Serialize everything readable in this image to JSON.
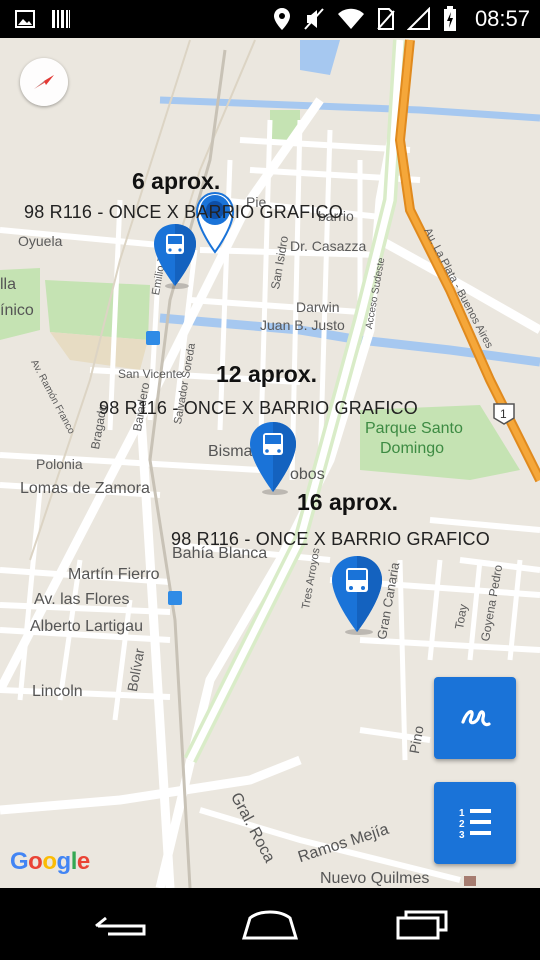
{
  "status_bar": {
    "time": "08:57",
    "left_icons": [
      "image-icon",
      "barcode-icon"
    ],
    "right_icons": [
      "location-icon",
      "mute-icon",
      "wifi-icon",
      "no-sim-icon",
      "signal-icon",
      "battery-charging-icon"
    ]
  },
  "map": {
    "labels": {
      "oyuela": "Oyuela",
      "lla": "lla",
      "inico": "ínico",
      "dr_casazza": "Dr. Casazza",
      "darwin": "Darwin",
      "juan_b_justo": "Juan B. Justo",
      "san_vicente": "San Vicente",
      "av_ramon_franco": "Av. Ramón Franco",
      "bragado": "Bragado",
      "baradero": "Baradero",
      "salvador_soreda": "Salvador Soreda",
      "san_isidro": "San Isidro",
      "emilio_zola": "Emilio Zola",
      "bismarck": "Bisma",
      "lobos": "obos",
      "polonia": "Polonia",
      "lomas_de_zamora": "Lomas de Zamora",
      "bahia_blanca": "Bahía Blanca",
      "martin_fierro": "Martín Fierro",
      "av_las_flores": "Av. las Flores",
      "alberto_lartigau": "Alberto Lartigau",
      "bolivar": "Bolívar",
      "lincoln": "Lincoln",
      "pino": "Pino",
      "gral_roca": "Gral. Roca",
      "ramos_mejia": "Ramos Mejía",
      "nuevo_quilmes": "Nuevo Quilmes",
      "parque_santo_domingo_1": "Parque Santo",
      "parque_santo_domingo_2": "Domingo",
      "autopista": "Au. La Plata - Buenos Aires",
      "acceso_sudeste": "Acceso Sudeste",
      "tres_arroyos": "Tres Arroyos",
      "toay": "Toay",
      "goyena_pedro": "Goyena Pedro",
      "gran_canaria": "Gran Canaria",
      "pierre_barrio": "Pie",
      "barrio": "barrio",
      "route_shield": "1"
    },
    "buses": [
      {
        "eta": "6 aprox.",
        "route": "98 R116 - ONCE X BARRIO GRAFICO"
      },
      {
        "eta": "12 aprox.",
        "route": "98 R116 - ONCE X BARRIO GRAFICO"
      },
      {
        "eta": "16 aprox.",
        "route": "98 R116 - ONCE X BARRIO GRAFICO"
      }
    ],
    "google_logo": [
      "G",
      "o",
      "o",
      "g",
      "l",
      "e"
    ]
  },
  "colors": {
    "fab": "#1a73d8",
    "pin": "#1a73d8",
    "highway": "#f0a030",
    "water": "#a6c8f0",
    "park": "#c5e3b3"
  },
  "buttons": {
    "route_button_icon": "route-icon",
    "list_button_icon": "numbered-list-icon"
  },
  "nav_bar": {
    "icons": [
      "back-icon",
      "home-icon",
      "recents-icon"
    ]
  }
}
